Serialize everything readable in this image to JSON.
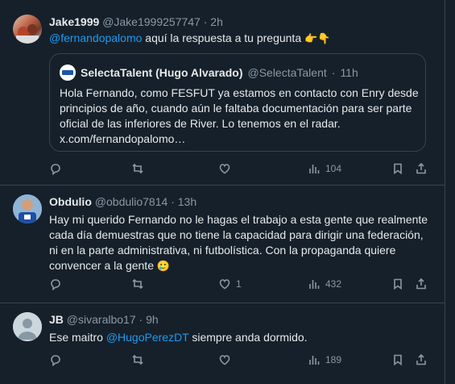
{
  "tweets": [
    {
      "name": "Jake1999",
      "handle": "@Jake1999257747",
      "dot": "·",
      "time": "2h",
      "mention": "@fernandopalomo",
      "text": " aquí la respuesta a tu pregunta ",
      "emoji": "👉👇",
      "quote": {
        "name": "SelectaTalent (Hugo Alvarado)",
        "handle": "@SelectaTalent",
        "dot": "·",
        "time": "11h",
        "text": "Hola Fernando, como FESFUT ya estamos en contacto con Enry desde principios de año, cuando aún le faltaba documentación para ser parte oficial de las inferiores de River. Lo tenemos en el radar. x.com/fernandopalomo…"
      },
      "views": "104",
      "likes": ""
    },
    {
      "name": "Obdulio",
      "handle": "@obdulio7814",
      "dot": "·",
      "time": "13h",
      "text": "Hay mi querido Fernando no le hagas el trabajo a esta gente que realmente cada día demuestras que no tiene la capacidad para dirigir una federación, ni en la parte administrativa, ni futbolística. Con la propaganda quiere convencer a la gente ",
      "emoji": "🥲",
      "likes": "1",
      "views": "432"
    },
    {
      "name": "JB",
      "handle": "@sivaralbo17",
      "dot": "·",
      "time": "9h",
      "text_before": "Ese maitro ",
      "mention": "@HugoPerezDT",
      "text_after": " siempre anda dormido.",
      "views": "189"
    }
  ],
  "icons": {
    "reply": "reply-icon",
    "retweet": "retweet-icon",
    "like": "heart-icon",
    "views": "views-icon",
    "bookmark": "bookmark-icon",
    "share": "share-icon"
  },
  "colors": {
    "background": "#15202b",
    "text": "#e7e9ea",
    "muted": "#8b98a5",
    "accent": "#1d9bf0",
    "border": "#38444d"
  }
}
